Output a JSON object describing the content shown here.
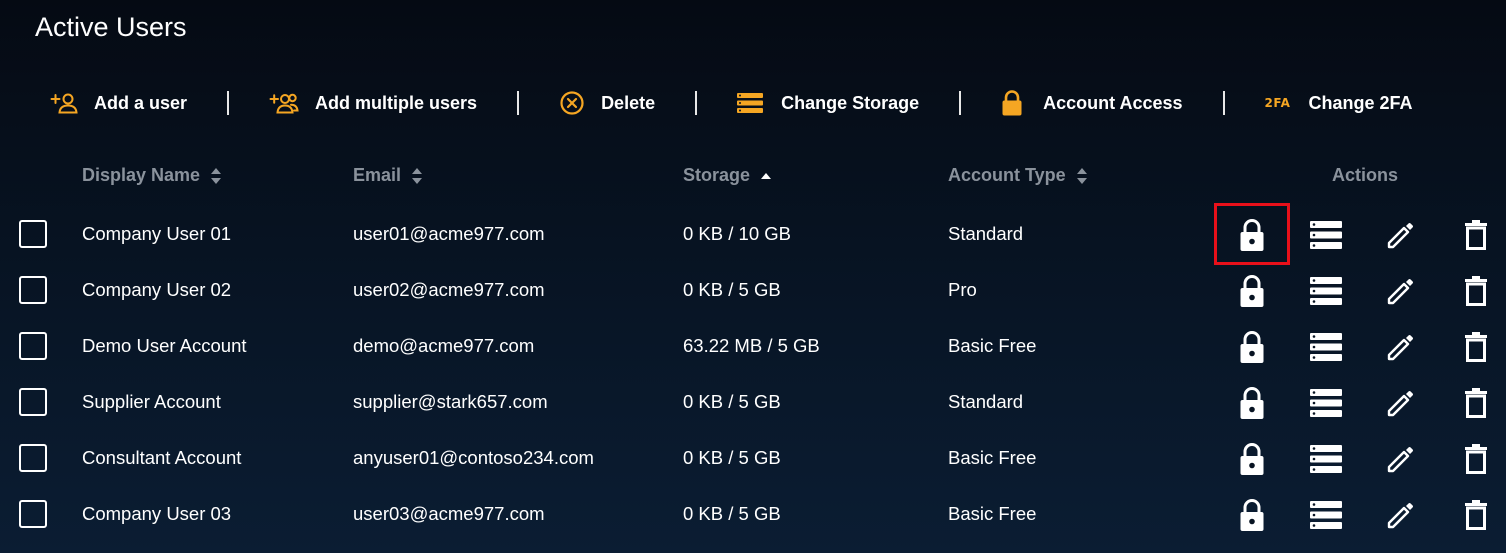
{
  "page": {
    "title": "Active Users"
  },
  "toolbar": {
    "add_user": {
      "label": "Add a user",
      "icon": "add-user-icon"
    },
    "add_multiple": {
      "label": "Add multiple users",
      "icon": "add-multiple-users-icon"
    },
    "delete": {
      "label": "Delete",
      "icon": "circle-x-icon"
    },
    "change_storage": {
      "label": "Change Storage",
      "icon": "storage-icon"
    },
    "account_access": {
      "label": "Account Access",
      "icon": "lock-icon"
    },
    "change_2fa": {
      "label": "Change 2FA",
      "icon": "2fa-icon",
      "badge": "2FA"
    }
  },
  "table": {
    "headers": {
      "display_name": "Display Name",
      "email": "Email",
      "storage": "Storage",
      "account_type": "Account Type",
      "actions": "Actions"
    },
    "sort": {
      "column": "storage",
      "direction": "ascending"
    },
    "rows": [
      {
        "name": "Company User 01",
        "email": "user01@acme977.com",
        "storage": "0 KB / 10 GB",
        "type": "Standard"
      },
      {
        "name": "Company User 02",
        "email": "user02@acme977.com",
        "storage": "0 KB / 5 GB",
        "type": "Pro"
      },
      {
        "name": "Demo User Account",
        "email": "demo@acme977.com",
        "storage": "63.22 MB / 5 GB",
        "type": "Basic Free"
      },
      {
        "name": "Supplier Account",
        "email": "supplier@stark657.com",
        "storage": "0 KB / 5 GB",
        "type": "Standard"
      },
      {
        "name": "Consultant Account",
        "email": "anyuser01@contoso234.com",
        "storage": "0 KB / 5 GB",
        "type": "Basic Free"
      },
      {
        "name": "Company User 03",
        "email": "user03@acme977.com",
        "storage": "0 KB / 5 GB",
        "type": "Basic Free"
      }
    ],
    "row_actions": [
      "lock-icon",
      "storage-icon",
      "pencil-icon",
      "trash-icon"
    ],
    "highlighted_action": {
      "row": 0,
      "action": "lock-icon"
    }
  },
  "colors": {
    "accent": "#f5a623",
    "header_text": "#8a929c",
    "highlight": "#e8101a",
    "background_top": "#050a13",
    "background_bottom": "#0b1d33"
  }
}
